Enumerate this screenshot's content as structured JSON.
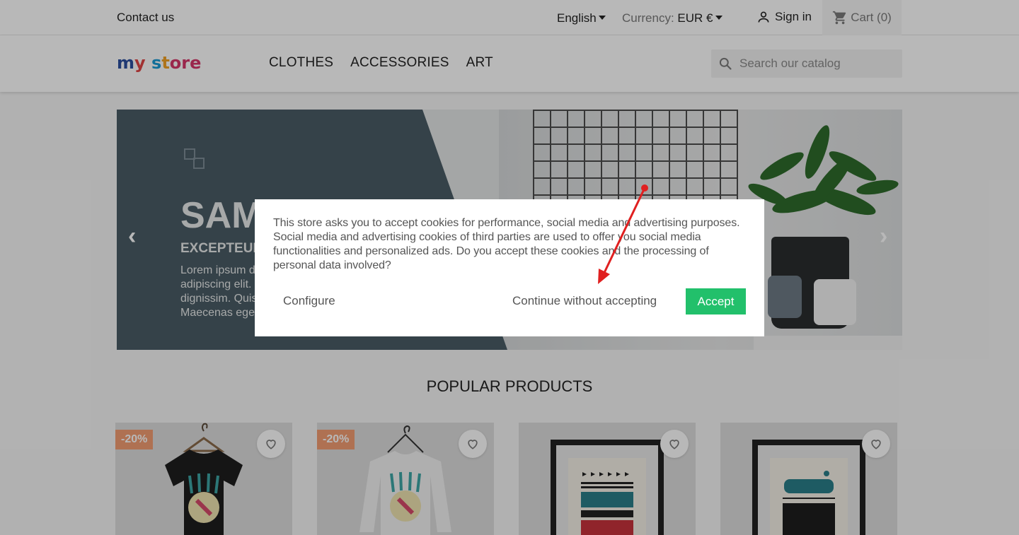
{
  "topbar": {
    "contact": "Contact us",
    "language": "English",
    "currency_label": "Currency:",
    "currency_value": "EUR €",
    "signin": "Sign in",
    "cart": "Cart (0)"
  },
  "header": {
    "logo": {
      "p1": "m",
      "p2": "y",
      "p3": " s",
      "p4": "t",
      "p5": "ore"
    },
    "menu": [
      "CLOTHES",
      "ACCESSORIES",
      "ART"
    ],
    "search_placeholder": "Search our catalog"
  },
  "slider": {
    "title": "SAMPLE 1",
    "subtitle": "EXCEPTEUR OCCAECAT",
    "lines": [
      "Lorem ipsum dolor sit amet, consectetur",
      "adipiscing elit. Proin tristique in tortor et",
      "dignissim. Quisque non tempor leo.",
      "Maecenas egestas sem elit"
    ]
  },
  "popular": {
    "title": "POPULAR PRODUCTS",
    "products": [
      {
        "badge": "-20%"
      },
      {
        "badge": "-20%"
      },
      {
        "badge": ""
      },
      {
        "badge": ""
      }
    ]
  },
  "modal": {
    "message": "This store asks you to accept cookies for performance, social media and advertising purposes. Social media and advertising cookies of third parties are used to offer you social media functionalities and personalized ads. Do you accept these cookies and the processing of personal data involved?",
    "configure": "Configure",
    "continue": "Continue without accepting",
    "accept": "Accept"
  },
  "colors": {
    "accept_button": "#22c06b",
    "annotation_arrow": "#e02020",
    "discount_badge": "#f39d72"
  }
}
